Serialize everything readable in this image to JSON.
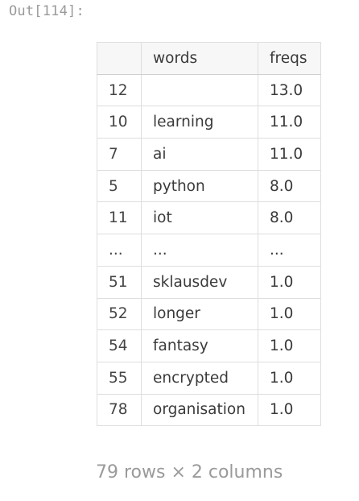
{
  "cell": {
    "prompt": "Out[114]:"
  },
  "table": {
    "index_header": "",
    "columns": [
      "words",
      "freqs"
    ],
    "rows": [
      {
        "index": "12",
        "words": "",
        "freqs": "13.0"
      },
      {
        "index": "10",
        "words": "learning",
        "freqs": "11.0"
      },
      {
        "index": "7",
        "words": "ai",
        "freqs": "11.0"
      },
      {
        "index": "5",
        "words": "python",
        "freqs": "8.0"
      },
      {
        "index": "11",
        "words": "iot",
        "freqs": "8.0"
      },
      {
        "index": "...",
        "words": "...",
        "freqs": "..."
      },
      {
        "index": "51",
        "words": "sklausdev",
        "freqs": "1.0"
      },
      {
        "index": "52",
        "words": "longer",
        "freqs": "1.0"
      },
      {
        "index": "54",
        "words": "fantasy",
        "freqs": "1.0"
      },
      {
        "index": "55",
        "words": "encrypted",
        "freqs": "1.0"
      },
      {
        "index": "78",
        "words": "organisation",
        "freqs": "1.0"
      }
    ]
  },
  "shape_text": "79 rows × 2 columns"
}
